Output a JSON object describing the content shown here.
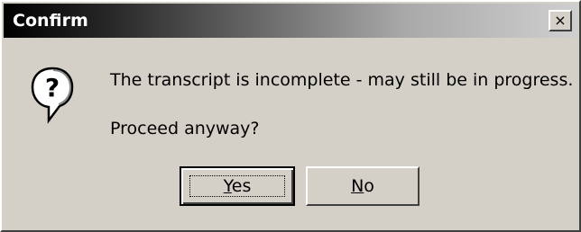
{
  "dialog": {
    "title": "Confirm",
    "close_symbol": "×",
    "message_line1": "The transcript is incomplete - may still be in progress.",
    "message_line2": "Proceed anyway?",
    "icon": "question-mark-icon"
  },
  "buttons": {
    "yes": {
      "mnemonic": "Y",
      "rest": "es"
    },
    "no": {
      "mnemonic": "N",
      "rest": "o"
    }
  }
}
